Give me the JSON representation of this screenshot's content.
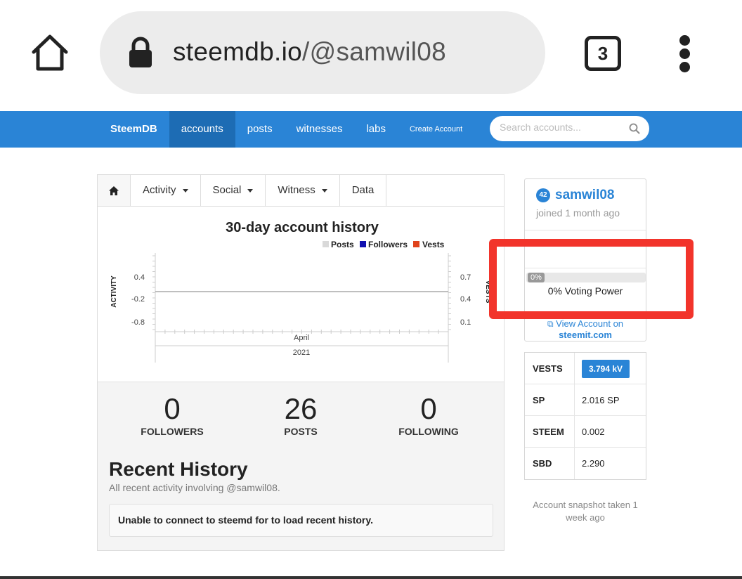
{
  "browser": {
    "url_host": "steemdb.io",
    "url_path": "/@samwil08",
    "tab_count": "3"
  },
  "navbar": {
    "brand": "SteemDB",
    "items": [
      {
        "label": "accounts",
        "active": true
      },
      {
        "label": "posts"
      },
      {
        "label": "witnesses"
      },
      {
        "label": "labs"
      },
      {
        "label": "Create Account"
      }
    ],
    "search_placeholder": "Search accounts..."
  },
  "tabs": [
    {
      "label": "Activity",
      "dropdown": true
    },
    {
      "label": "Social",
      "dropdown": true
    },
    {
      "label": "Witness",
      "dropdown": true
    },
    {
      "label": "Data",
      "dropdown": false
    }
  ],
  "chart_data": {
    "type": "line",
    "title": "30-day account history",
    "legend": [
      {
        "name": "Posts",
        "color": "#d9d9d9"
      },
      {
        "name": "Followers",
        "color": "#1010b0"
      },
      {
        "name": "Vests",
        "color": "#e0431c"
      }
    ],
    "legend_position": "top-right",
    "ylabel_left": "ACTIVITY",
    "ylabel_right": "VESTS",
    "y_left_ticks": [
      "0.4",
      "-0.2",
      "-0.8"
    ],
    "y_right_ticks": [
      "0.7",
      "0.4",
      "0.1"
    ],
    "x_label": "April",
    "x_sublabel": "2021",
    "series": [
      {
        "name": "Posts",
        "values": [
          0
        ]
      },
      {
        "name": "Followers",
        "values": [
          0
        ]
      },
      {
        "name": "Vests",
        "values": [
          0
        ]
      }
    ]
  },
  "stats": [
    {
      "value": "0",
      "label": "FOLLOWERS"
    },
    {
      "value": "26",
      "label": "POSTS"
    },
    {
      "value": "0",
      "label": "FOLLOWING"
    }
  ],
  "recent_history": {
    "title": "Recent History",
    "subtitle": "All recent activity involving @samwil08.",
    "message": "Unable to connect to steemd for to load recent history."
  },
  "profile": {
    "reputation": "42",
    "name": "samwil08",
    "joined": "joined 1 month ago",
    "voting_power_pct": "0%",
    "voting_power_value": 0,
    "voting_power_label": "0% Voting Power",
    "view_link_line1": "View Account on",
    "view_link_line2": "steemit.com"
  },
  "balances": [
    {
      "key": "VESTS",
      "value": "3.794 kV",
      "pill": true
    },
    {
      "key": "SP",
      "value": "2.016 SP"
    },
    {
      "key": "STEEM",
      "value": "0.002"
    },
    {
      "key": "SBD",
      "value": "2.290"
    }
  ],
  "snapshot_note": "Account snapshot taken 1 week ago",
  "colors": {
    "navbar": "#2a84d6",
    "navbar_active": "#1d6cb4",
    "highlight": "#f2342b"
  }
}
